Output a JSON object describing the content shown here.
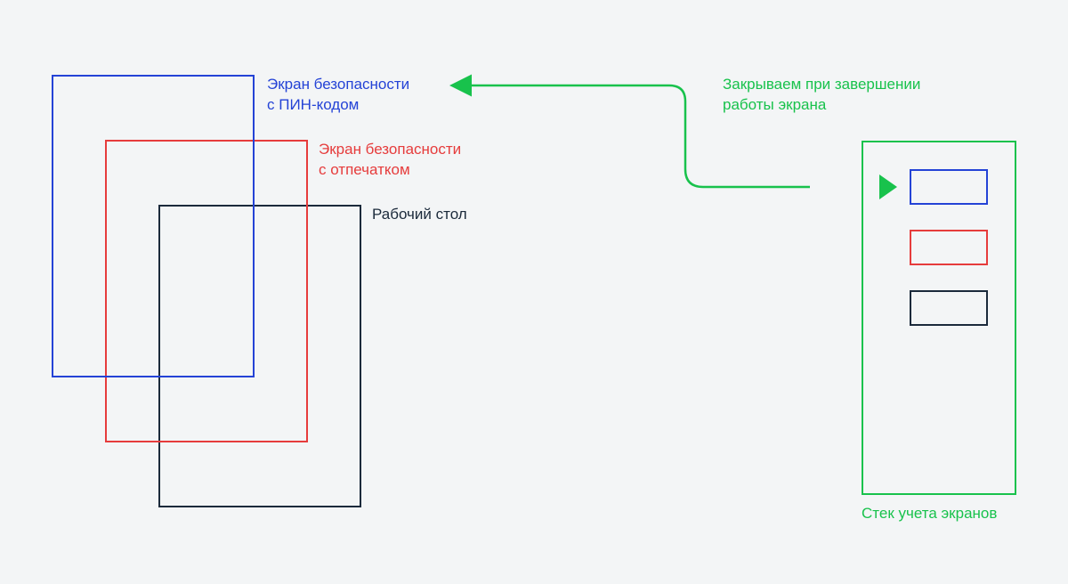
{
  "labels": {
    "pin_screen": "Экран безопасности\nс ПИН-кодом",
    "fp_screen": "Экран безопасности\nс отпечатком",
    "desktop": "Рабочий стол",
    "close_note": "Закрываем при завершении\nработы экрана",
    "stack_caption": "Стек учета экранов"
  },
  "colors": {
    "blue": "#2443d6",
    "red": "#e63c3c",
    "navy": "#1b2a3b",
    "green": "#18c24c"
  },
  "stack_items": [
    "blue",
    "red",
    "navy"
  ]
}
